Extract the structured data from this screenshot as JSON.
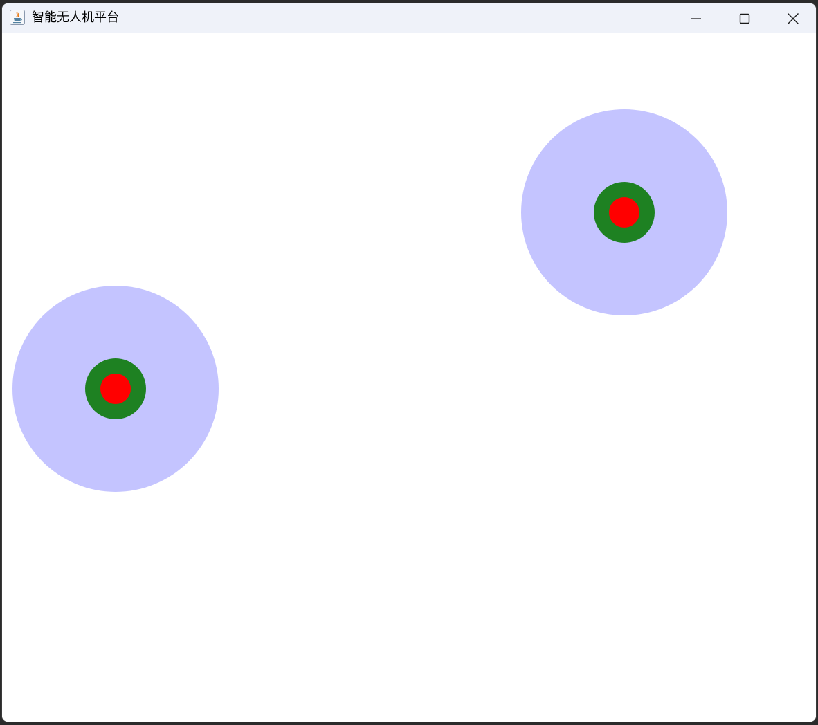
{
  "window": {
    "title": "智能无人机平台"
  },
  "titlebar_buttons": {
    "minimize_icon": "minimize-icon",
    "maximize_icon": "maximize-icon",
    "close_icon": "close-icon"
  },
  "colors": {
    "titlebar_bg": "#eff2f9",
    "canvas_bg": "#ffffff",
    "range_fill": "#c4c4ff",
    "body_ring": "#1e8122",
    "core": "#ff0000"
  },
  "drones": [
    {
      "label": ""
    },
    {
      "label": ""
    }
  ]
}
